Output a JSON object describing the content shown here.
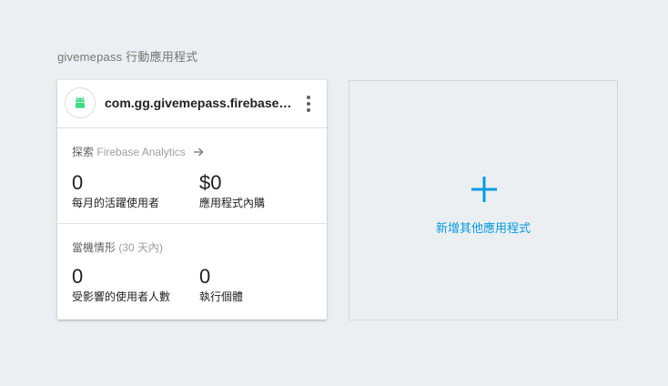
{
  "section_title": "givemepass 行動應用程式",
  "app_card": {
    "platform_icon": "android-icon",
    "app_id": "com.gg.givemepass.firebasestorage",
    "menu_icon": "more-vert-icon",
    "analytics": {
      "explore_prefix": "探索",
      "explore_product": "Firebase Analytics",
      "arrow_icon": "arrow-right-icon",
      "metrics": [
        {
          "value": "0",
          "caption": "每月的活躍使用者"
        },
        {
          "value": "$0",
          "caption": "應用程式內購"
        }
      ]
    },
    "stability": {
      "label": "當機情形",
      "range": "(30 天內)",
      "metrics": [
        {
          "value": "0",
          "caption": "受影響的使用者人數"
        },
        {
          "value": "0",
          "caption": "執行個體"
        }
      ]
    }
  },
  "add_app": {
    "icon": "plus-icon",
    "label": "新增其他應用程式",
    "accent_color": "#039be5"
  },
  "colors": {
    "background": "#eceff1",
    "android_green": "#3ddc84",
    "accent": "#039be5"
  }
}
